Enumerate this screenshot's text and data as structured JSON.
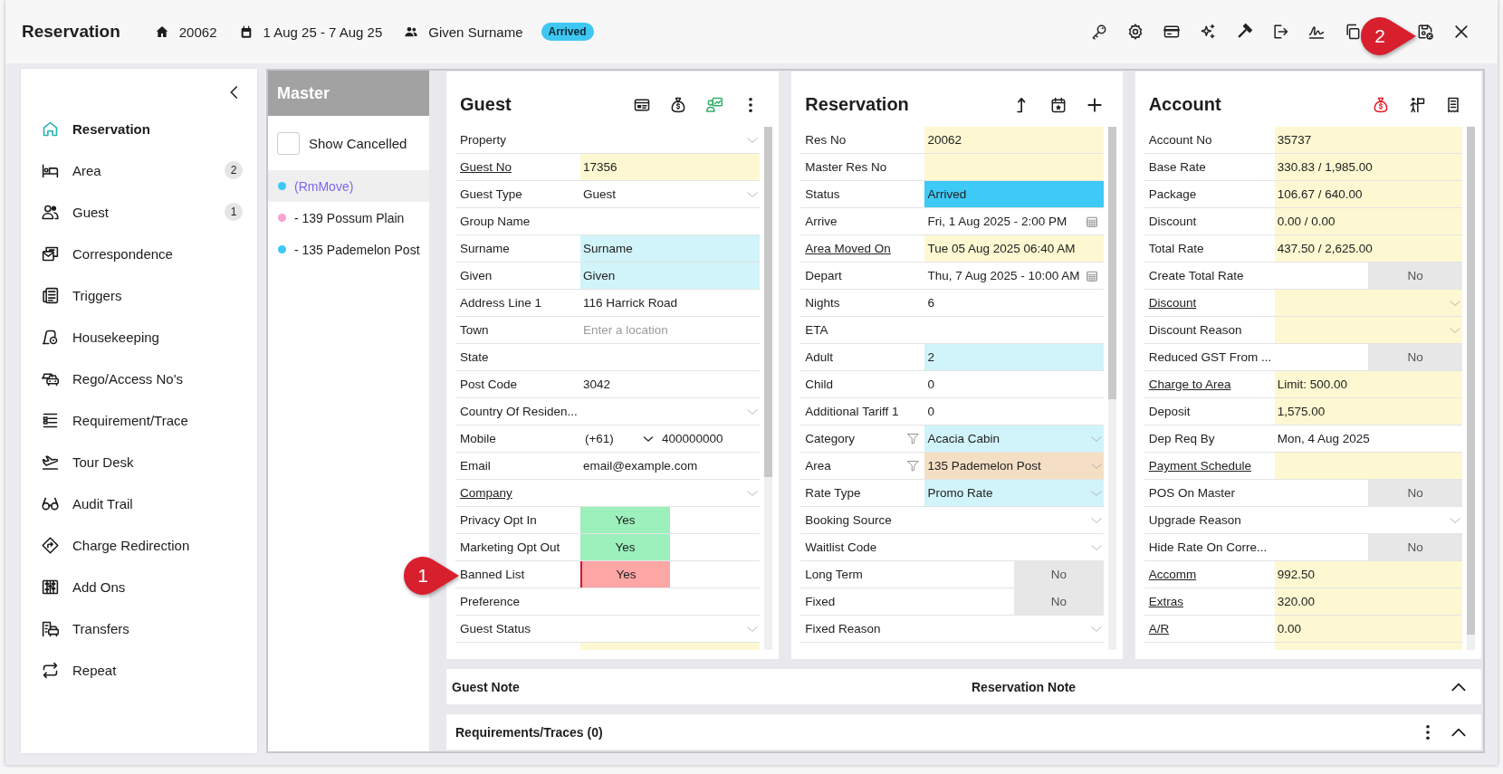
{
  "header": {
    "title": "Reservation",
    "reservation_no": "20062",
    "dates": "1 Aug 25 - 7 Aug 25",
    "guest_name": "Given Surname",
    "status": "Arrived"
  },
  "sidebar": {
    "items": [
      {
        "label": "Reservation",
        "selected": true
      },
      {
        "label": "Area",
        "count": "2",
        "selected": false
      },
      {
        "label": "Guest",
        "count": "1",
        "selected": false
      },
      {
        "label": "Correspondence",
        "selected": false
      },
      {
        "label": "Triggers",
        "selected": false
      },
      {
        "label": "Housekeeping",
        "selected": false
      },
      {
        "label": "Rego/Access No's",
        "selected": false
      },
      {
        "label": "Requirement/Trace",
        "selected": false
      },
      {
        "label": "Tour Desk",
        "selected": false
      },
      {
        "label": "Audit Trail",
        "selected": false
      },
      {
        "label": "Charge Redirection",
        "selected": false
      },
      {
        "label": "Add Ons",
        "selected": false
      },
      {
        "label": "Transfers",
        "selected": false
      },
      {
        "label": "Repeat",
        "selected": false
      }
    ]
  },
  "master": {
    "title": "Master",
    "show_cancelled": {
      "label": "Show Cancelled",
      "checked": false
    },
    "items": [
      {
        "label": "(RmMove)",
        "color": "#3ec7f5",
        "selected": true
      },
      {
        "label": "- 139 Possum Plain",
        "color": "#f7a3d2",
        "selected": false
      },
      {
        "label": "- 135 Pademelon Post",
        "color": "#3ec7f5",
        "selected": false
      }
    ]
  },
  "panels": [
    {
      "title": "Guest",
      "cut_row": {
        "color": "#fdf8d1"
      },
      "rows": [
        {
          "label": "Property",
          "kind": "select",
          "link": false
        },
        {
          "label": "Guest No",
          "kind": "text",
          "value": "17356",
          "color": "#fdf8d1",
          "link": true
        },
        {
          "label": "Guest Type",
          "kind": "select",
          "value": "Guest",
          "link": false
        },
        {
          "label": "Group Name",
          "kind": "text",
          "link": false
        },
        {
          "label": "Surname",
          "kind": "text",
          "value": "Surname",
          "color": "#d0f4fa",
          "link": false
        },
        {
          "label": "Given",
          "kind": "text",
          "value": "Given",
          "color": "#d0f4fa",
          "link": false
        },
        {
          "label": "Address Line 1",
          "kind": "text",
          "value": "116 Harrick Road",
          "link": false
        },
        {
          "label": "Town",
          "kind": "text",
          "placeholder": "Enter a location",
          "link": false
        },
        {
          "label": "State",
          "kind": "text",
          "link": false
        },
        {
          "label": "Post Code",
          "kind": "text",
          "value": "3042",
          "link": false
        },
        {
          "label": "Country Of Residen...",
          "kind": "select",
          "link": false
        },
        {
          "label": "Mobile",
          "kind": "phone",
          "code": "(+61)",
          "value": "400000000",
          "link": false
        },
        {
          "label": "Email",
          "kind": "text",
          "value": "email@example.com",
          "link": false
        },
        {
          "label": "Company",
          "kind": "select",
          "link": true
        },
        {
          "label": "Privacy Opt In",
          "kind": "toggle",
          "on": true,
          "alert": false,
          "value": "Yes",
          "color": "#9cf0bb",
          "link": false
        },
        {
          "label": "Marketing Opt Out",
          "kind": "toggle",
          "on": true,
          "alert": false,
          "value": "Yes",
          "color": "#9cf0bb",
          "link": false
        },
        {
          "label": "Banned List",
          "kind": "toggle",
          "on": true,
          "alert": true,
          "value": "Yes",
          "color": "#fca6a6",
          "link": false
        },
        {
          "label": "Preference",
          "kind": "text",
          "link": false
        },
        {
          "label": "Guest Status",
          "kind": "select",
          "link": false
        }
      ]
    },
    {
      "title": "Reservation",
      "rows": [
        {
          "label": "Res No",
          "kind": "text",
          "value": "20062",
          "color": "#fdf8d1",
          "link": false
        },
        {
          "label": "Master Res No",
          "kind": "text",
          "color": "#fdf8d1",
          "link": false
        },
        {
          "label": "Status",
          "kind": "text",
          "value": "Arrived",
          "color": "#3ecaf7",
          "link": false
        },
        {
          "label": "Arrive",
          "kind": "date",
          "value": "Fri, 1 Aug 2025 - 2:00 PM",
          "link": false
        },
        {
          "label": "Area Moved On",
          "kind": "text",
          "value": "Tue 05 Aug 2025 06:40 AM",
          "color": "#fdf8d1",
          "link": true
        },
        {
          "label": "Depart",
          "kind": "date",
          "value": "Thu, 7 Aug 2025 - 10:00 AM",
          "link": false
        },
        {
          "label": "Nights",
          "kind": "text",
          "value": "6",
          "link": false
        },
        {
          "label": "ETA",
          "kind": "text",
          "link": false
        },
        {
          "label": "Adult",
          "kind": "text",
          "value": "2",
          "color": "#d0f4fa",
          "link": false
        },
        {
          "label": "Child",
          "kind": "text",
          "value": "0",
          "link": false
        },
        {
          "label": "Additional Tariff 1",
          "kind": "text",
          "value": "0",
          "link": false
        },
        {
          "label": "Category",
          "kind": "filter-select",
          "value": "Acacia Cabin",
          "color": "#d0f4fa",
          "link": false
        },
        {
          "label": "Area",
          "kind": "filter-select",
          "value": "135 Pademelon Post",
          "color": "#f4dfc5",
          "link": false
        },
        {
          "label": "Rate Type",
          "kind": "select",
          "value": "Promo Rate",
          "color": "#d0f4fa",
          "link": false
        },
        {
          "label": "Booking Source",
          "kind": "select",
          "link": false
        },
        {
          "label": "Waitlist Code",
          "kind": "select",
          "link": false
        },
        {
          "label": "Long Term",
          "kind": "toggle",
          "on": false,
          "alert": false,
          "value": "No",
          "color": "#e7e7e7",
          "link": false
        },
        {
          "label": "Fixed",
          "kind": "toggle",
          "on": false,
          "alert": false,
          "value": "No",
          "color": "#e7e7e7",
          "link": false
        },
        {
          "label": "Fixed Reason",
          "kind": "select",
          "link": false
        }
      ]
    },
    {
      "title": "Account",
      "cut_row": {
        "color": "#fdf8d1"
      },
      "rows": [
        {
          "label": "Account No",
          "kind": "text",
          "value": "35737",
          "color": "#fdf8d1",
          "link": false
        },
        {
          "label": "Base Rate",
          "kind": "text",
          "value": "330.83 / 1,985.00",
          "color": "#fdf8d1",
          "link": false
        },
        {
          "label": "Package",
          "kind": "text",
          "value": "106.67 / 640.00",
          "color": "#fdf8d1",
          "link": false
        },
        {
          "label": "Discount",
          "kind": "text",
          "value": "0.00 / 0.00",
          "color": "#fdf8d1",
          "link": false
        },
        {
          "label": "Total Rate",
          "kind": "text",
          "value": "437.50 / 2,625.00",
          "color": "#fdf8d1",
          "link": false
        },
        {
          "label": "Create Total Rate",
          "kind": "toggle",
          "on": false,
          "alert": false,
          "value": "No",
          "color": "#e7e7e7",
          "link": false
        },
        {
          "label": "Discount",
          "kind": "select",
          "color": "#fdf8d1",
          "link": true
        },
        {
          "label": "Discount Reason",
          "kind": "select",
          "color": "#fdf8d1",
          "link": false
        },
        {
          "label": "Reduced GST From ...",
          "kind": "toggle",
          "on": false,
          "alert": false,
          "value": "No",
          "color": "#e7e7e7",
          "link": false
        },
        {
          "label": "Charge to Area",
          "kind": "text",
          "value": "Limit: 500.00",
          "color": "#fdf8d1",
          "link": true
        },
        {
          "label": "Deposit",
          "kind": "text",
          "value": "1,575.00",
          "color": "#fdf8d1",
          "link": false
        },
        {
          "label": "Dep Req By",
          "kind": "text",
          "value": "Mon, 4 Aug 2025",
          "link": false
        },
        {
          "label": "Payment Schedule",
          "kind": "text",
          "color": "#fdf8d1",
          "link": true
        },
        {
          "label": "POS On Master",
          "kind": "toggle",
          "on": false,
          "alert": false,
          "value": "No",
          "color": "#e7e7e7",
          "link": false
        },
        {
          "label": "Upgrade Reason",
          "kind": "select",
          "link": false
        },
        {
          "label": "Hide Rate On Corre...",
          "kind": "toggle",
          "on": false,
          "alert": false,
          "value": "No",
          "color": "#e7e7e7",
          "link": false
        },
        {
          "label": "Accomm",
          "kind": "text",
          "value": "992.50",
          "color": "#fdf8d1",
          "link": true
        },
        {
          "label": "Extras",
          "kind": "text",
          "value": "320.00",
          "color": "#fdf8d1",
          "link": true
        },
        {
          "label": "A/R",
          "kind": "text",
          "value": "0.00",
          "color": "#fdf8d1",
          "link": true
        }
      ]
    }
  ],
  "notes": {
    "guest_title": "Guest Note",
    "reservation_title": "Reservation Note"
  },
  "requirements": {
    "title": "Requirements/Traces (0)"
  },
  "callouts": [
    {
      "label": "1"
    },
    {
      "label": "2"
    }
  ]
}
